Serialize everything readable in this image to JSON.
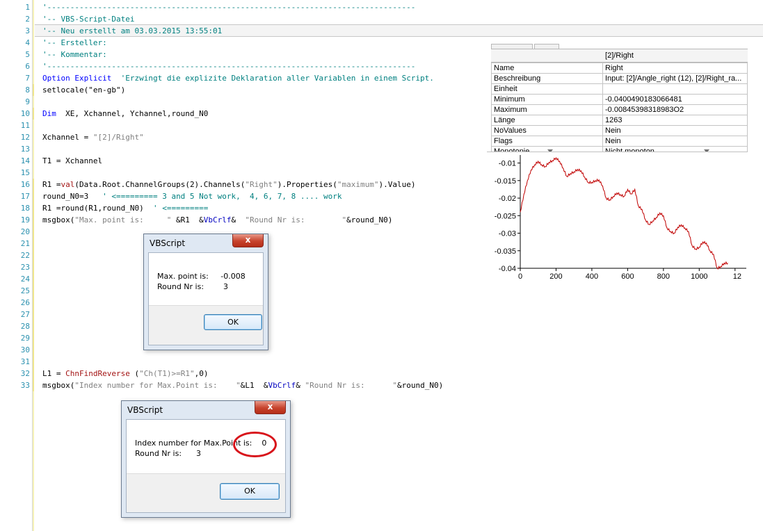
{
  "editor": {
    "line_numbers": [
      "1",
      "2",
      "3",
      "4",
      "5",
      "6",
      "7",
      "8",
      "9",
      "10",
      "11",
      "12",
      "13",
      "14",
      "15",
      "16",
      "17",
      "18",
      "19",
      "20",
      "21",
      "22",
      "23",
      "24",
      "25",
      "26",
      "27",
      "28",
      "29",
      "30",
      "31",
      "32",
      "33"
    ],
    "code": {
      "l1": "'--------------------------------------------------------------------------------",
      "l2": "'-- VBS-Script-Datei",
      "l3": "'-- Neu erstellt am 03.03.2015 13:55:01",
      "l4": "'-- Ersteller:",
      "l5": "'-- Kommentar:",
      "l6": "'--------------------------------------------------------------------------------",
      "l7_kw": "Option Explicit",
      "l7_cm": "  'Erzwingt die explizite Deklaration aller Variablen in einem Script.",
      "l8": "setlocale(\"en-gb\")",
      "l10_kw": "Dim",
      "l10_rest": "  XE, Xchannel, Ychannel,round_N0",
      "l12_a": "Xchannel = ",
      "l12_s": "\"[2]/Right\"",
      "l14": "T1 = Xchannel",
      "l16_a": "R1 =",
      "l16_fn": "val",
      "l16_b": "(Data.Root.ChannelGroups(2).Channels(",
      "l16_s1": "\"Right\"",
      "l16_c": ").Properties(",
      "l16_s2": "\"maximum\"",
      "l16_d": ").Value)",
      "l17_a": "round_N0=3",
      "l17_cm": "   ' <========= 3 and 5 Not work,  4, 6, 7, 8 .... work",
      "l18_a": "R1 =round(R1,round_N0)",
      "l18_cm": "  ' <=========",
      "l19_a": "msgbox(",
      "l19_s1": "\"Max. point is:     \"",
      "l19_b": " &R1  &",
      "l19_vb": "VbCrlf",
      "l19_c": "&  ",
      "l19_s2": "\"Round Nr is:        \"",
      "l19_d": "&round_N0)",
      "l32_a": "L1 = ",
      "l32_fn": "ChnFindReverse",
      "l32_b": " (",
      "l32_s": "\"Ch(T1)>=R1\"",
      "l32_c": ",0)",
      "l33_a": "msgbox(",
      "l33_s1": "\"Index number for Max.Point is:    \"",
      "l33_b": "&L1  &",
      "l33_vb": "VbCrlf",
      "l33_c": "& ",
      "l33_s2": "\"Round Nr is:      \"",
      "l33_d": "&round_N0)"
    }
  },
  "dialog1": {
    "title": "VBScript",
    "close": "x",
    "line1": "Max. point is:     -0.008",
    "line2": "Round Nr is:        3",
    "ok": "OK"
  },
  "dialog2": {
    "title": "VBScript",
    "close": "x",
    "line1": "Index number for Max.Point is:    0",
    "line2": "Round Nr is:      3",
    "ok": "OK",
    "highlight_color": "#d8141b"
  },
  "properties": {
    "header": "[2]/Right",
    "rows": [
      {
        "key": "Name",
        "value": "Right"
      },
      {
        "key": "Beschreibung",
        "value": "Input: [2]/Angle_right (12), [2]/Right_ra..."
      },
      {
        "key": "Einheit",
        "value": ""
      },
      {
        "key": "Minimum",
        "value": "-0.0400490183066481"
      },
      {
        "key": "Maximum",
        "value": "-0.00845398318983O2"
      },
      {
        "key": "Länge",
        "value": "1263"
      },
      {
        "key": "NoValues",
        "value": "Nein"
      },
      {
        "key": "Flags",
        "value": "Nein"
      },
      {
        "key": "Monotonie",
        "value": "Nicht monoton"
      }
    ]
  },
  "chart_data": {
    "type": "line",
    "xlim": [
      0,
      1263
    ],
    "ylim": [
      -0.04,
      -0.008
    ],
    "x_ticks": [
      "0",
      "200",
      "400",
      "600",
      "800",
      "1000",
      "12"
    ],
    "y_ticks": [
      "-0.01",
      "-0.015",
      "-0.02",
      "-0.025",
      "-0.03",
      "-0.035",
      "-0.04"
    ],
    "color": "#c00000",
    "series": [
      {
        "x": [
          0,
          20,
          40,
          60,
          80,
          100,
          120,
          140,
          160,
          180,
          200,
          220,
          240,
          260,
          280,
          300,
          320,
          340,
          360,
          380,
          400,
          420,
          440,
          460,
          480,
          500,
          520,
          540,
          560,
          580,
          600,
          620,
          640,
          660,
          680,
          700,
          720,
          740,
          760,
          780,
          800,
          820,
          840,
          860,
          880,
          900,
          920,
          940,
          960,
          980,
          1000,
          1020,
          1040,
          1060,
          1080,
          1100,
          1120,
          1140,
          1160
        ],
        "y": [
          -0.024,
          -0.019,
          -0.015,
          -0.012,
          -0.0105,
          -0.0095,
          -0.0105,
          -0.011,
          -0.0098,
          -0.0093,
          -0.0085,
          -0.0095,
          -0.0115,
          -0.0138,
          -0.013,
          -0.0125,
          -0.0118,
          -0.0122,
          -0.014,
          -0.0155,
          -0.0155,
          -0.015,
          -0.0148,
          -0.0165,
          -0.02,
          -0.0205,
          -0.0195,
          -0.0185,
          -0.019,
          -0.0195,
          -0.0175,
          -0.0188,
          -0.0175,
          -0.0222,
          -0.0232,
          -0.0262,
          -0.0275,
          -0.0265,
          -0.0255,
          -0.0242,
          -0.025,
          -0.0285,
          -0.0295,
          -0.03,
          -0.0283,
          -0.0276,
          -0.0285,
          -0.0295,
          -0.0335,
          -0.0345,
          -0.034,
          -0.0325,
          -0.0328,
          -0.035,
          -0.036,
          -0.04,
          -0.0395,
          -0.0385,
          -0.0385
        ]
      }
    ]
  }
}
